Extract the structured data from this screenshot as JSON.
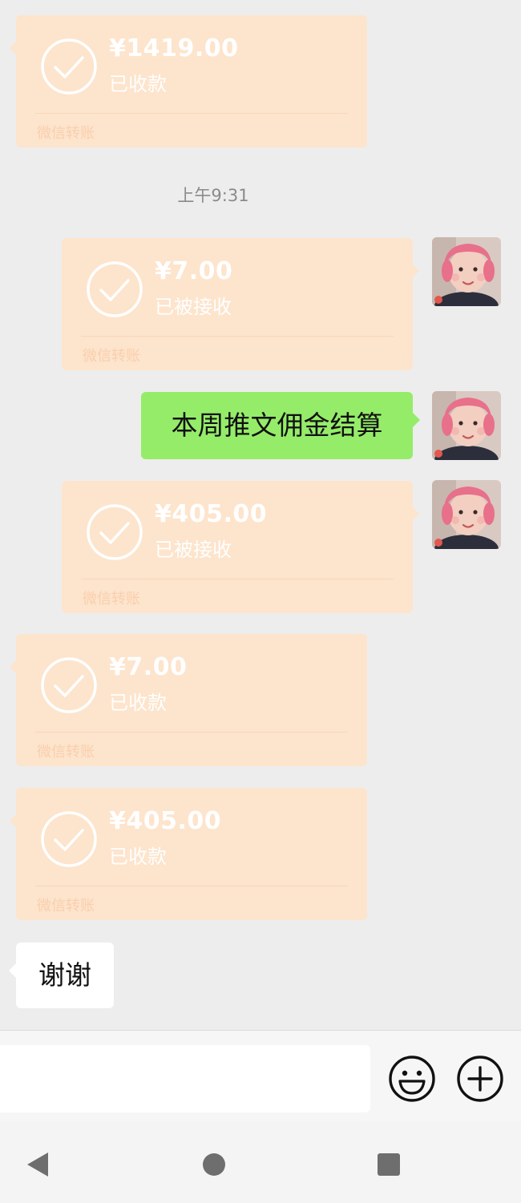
{
  "chat": {
    "transfers": [
      {
        "amount": "¥1419.00",
        "status": "已收款",
        "footer": "微信转账"
      },
      {
        "amount": "¥7.00",
        "status": "已被接收",
        "footer": "微信转账"
      },
      {
        "amount": "¥405.00",
        "status": "已被接收",
        "footer": "微信转账"
      },
      {
        "amount": "¥7.00",
        "status": "已收款",
        "footer": "微信转账"
      },
      {
        "amount": "¥405.00",
        "status": "已收款",
        "footer": "微信转账"
      }
    ],
    "timestamp": "上午9:31",
    "sent_text": "本周推文佣金结算",
    "received_text": "谢谢"
  },
  "input_bar": {
    "input_value": "",
    "emoji_icon": "smiley-face-icon",
    "plus_icon": "plus-circle-icon"
  },
  "nav_bar": {
    "back_icon": "triangle-back-icon",
    "home_icon": "circle-home-icon",
    "recents_icon": "square-recents-icon"
  },
  "colors": {
    "transfer_bubble": "#fde4cc",
    "sent_bubble": "#95ec69",
    "chat_background": "#ededed"
  }
}
